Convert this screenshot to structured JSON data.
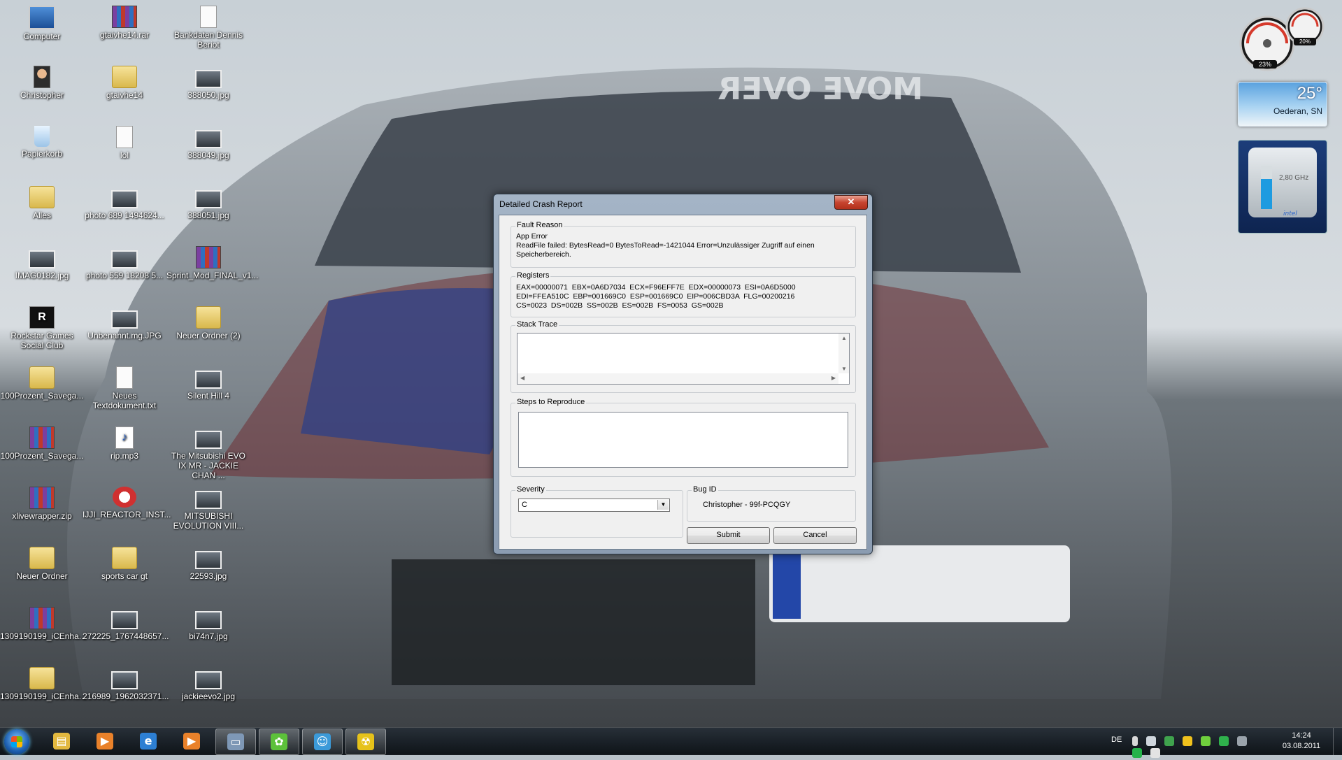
{
  "desktop": {
    "icons": [
      {
        "label": "Computer",
        "icon": "computer-icon"
      },
      {
        "label": "gtaivhe14.rar",
        "icon": "rar-archive-icon"
      },
      {
        "label": "Bankdaten Dennis Beriot",
        "icon": "text-file-icon"
      },
      {
        "label": "Christopher",
        "icon": "user-folder-icon"
      },
      {
        "label": "gtaivhe14",
        "icon": "folder-icon"
      },
      {
        "label": "388050.jpg",
        "icon": "image-file-icon"
      },
      {
        "label": "Papierkorb",
        "icon": "recycle-bin-icon"
      },
      {
        "label": "lol",
        "icon": "text-file-icon"
      },
      {
        "label": "388049.jpg",
        "icon": "image-file-icon"
      },
      {
        "label": "Alles",
        "icon": "folder-icon"
      },
      {
        "label": "photo 689 1494624...",
        "icon": "image-file-icon"
      },
      {
        "label": "388051.jpg",
        "icon": "image-file-icon"
      },
      {
        "label": "IMAG0182.jpg",
        "icon": "image-file-icon"
      },
      {
        "label": "photo 559 18208 5...",
        "icon": "image-file-icon"
      },
      {
        "label": "Sprint_Mod_FINAL_v1...",
        "icon": "rar-archive-icon"
      },
      {
        "label": "Rockstar Games Social Club",
        "icon": "rockstar-icon"
      },
      {
        "label": "Unbenannt.mg.JPG",
        "icon": "image-file-icon"
      },
      {
        "label": "Neuer Ordner (2)",
        "icon": "folder-icon"
      },
      {
        "label": "100Prozent_Savega...",
        "icon": "folder-icon"
      },
      {
        "label": "Neues Textdokument.txt",
        "icon": "text-file-icon"
      },
      {
        "label": "Silent Hill 4",
        "icon": "game-shortcut-icon"
      },
      {
        "label": "100Prozent_Savega...",
        "icon": "rar-archive-icon"
      },
      {
        "label": "rip.mp3",
        "icon": "mp3-file-icon"
      },
      {
        "label": "The Mitsubishi EVO IX MR - JACKIE CHAN ...",
        "icon": "image-file-icon"
      },
      {
        "label": "xlivewrapper.zip",
        "icon": "rar-archive-icon"
      },
      {
        "label": "IJJI_REACTOR_INST...",
        "icon": "installer-icon"
      },
      {
        "label": "MITSUBISHI EVOLUTION VIII...",
        "icon": "image-file-icon"
      },
      {
        "label": "Neuer Ordner",
        "icon": "folder-icon"
      },
      {
        "label": "sports car gt",
        "icon": "folder-icon"
      },
      {
        "label": "22593.jpg",
        "icon": "image-file-icon"
      },
      {
        "label": "1309190199_iCEnha...",
        "icon": "rar-archive-icon"
      },
      {
        "label": "272225_1767448657...",
        "icon": "image-file-icon"
      },
      {
        "label": "bi74n7.jpg",
        "icon": "image-file-icon"
      },
      {
        "label": "1309190199_iCEnha...",
        "icon": "folder-icon"
      },
      {
        "label": "216989_1962032371...",
        "icon": "image-file-icon"
      },
      {
        "label": "jackieevo2.jpg",
        "icon": "image-file-icon"
      }
    ],
    "wallpaper_text": "MOVE OVER"
  },
  "gadgets": {
    "cpu": {
      "left_percent": "23%",
      "right_percent": "20%"
    },
    "weather": {
      "temperature": "25°",
      "location": "Oederan, SN"
    },
    "cpu_meter": {
      "frequency": "2,80 GHz",
      "brand": "intel",
      "fill_fraction": 0.7
    }
  },
  "dialog": {
    "title": "Detailed Crash Report",
    "fault_reason": {
      "legend": "Fault Reason",
      "line1": "App Error",
      "line2": "ReadFile failed: BytesRead=0 BytesToRead=-1421044 Error=Unzulässiger Zugriff auf einen",
      "line3": "Speicherbereich."
    },
    "registers": {
      "legend": "Registers",
      "line1": "EAX=00000071  EBX=0A6D7034  ECX=F96EFF7E  EDX=00000073  ESI=0A6D5000",
      "line2": "EDI=FFEA510C  EBP=001669C0  ESP=001669C0  EIP=006CBD3A  FLG=00200216",
      "line3": "CS=0023  DS=002B  SS=002B  ES=002B  FS=0053  GS=002B"
    },
    "stack_trace": {
      "legend": "Stack Trace",
      "value": ""
    },
    "steps": {
      "legend": "Steps to Reproduce",
      "value": ""
    },
    "severity": {
      "legend": "Severity",
      "selected": "C"
    },
    "bug_id": {
      "legend": "Bug ID",
      "value": "Christopher - 99f-PCQGY"
    },
    "submit_label": "Submit",
    "cancel_label": "Cancel"
  },
  "taskbar": {
    "buttons": [
      {
        "name": "explorer",
        "icon": "folder-icon"
      },
      {
        "name": "media-player",
        "icon": "media-player-icon"
      },
      {
        "name": "internet-explorer",
        "icon": "ie-icon"
      },
      {
        "name": "media-player-2",
        "icon": "media-player-icon"
      },
      {
        "name": "app-window",
        "icon": "window-icon"
      },
      {
        "name": "icq",
        "icon": "flower-icon"
      },
      {
        "name": "messenger",
        "icon": "people-icon"
      },
      {
        "name": "radioactive-app",
        "icon": "radioactive-icon"
      }
    ],
    "language": "DE",
    "time": "14:24",
    "date": "03.08.2011"
  }
}
